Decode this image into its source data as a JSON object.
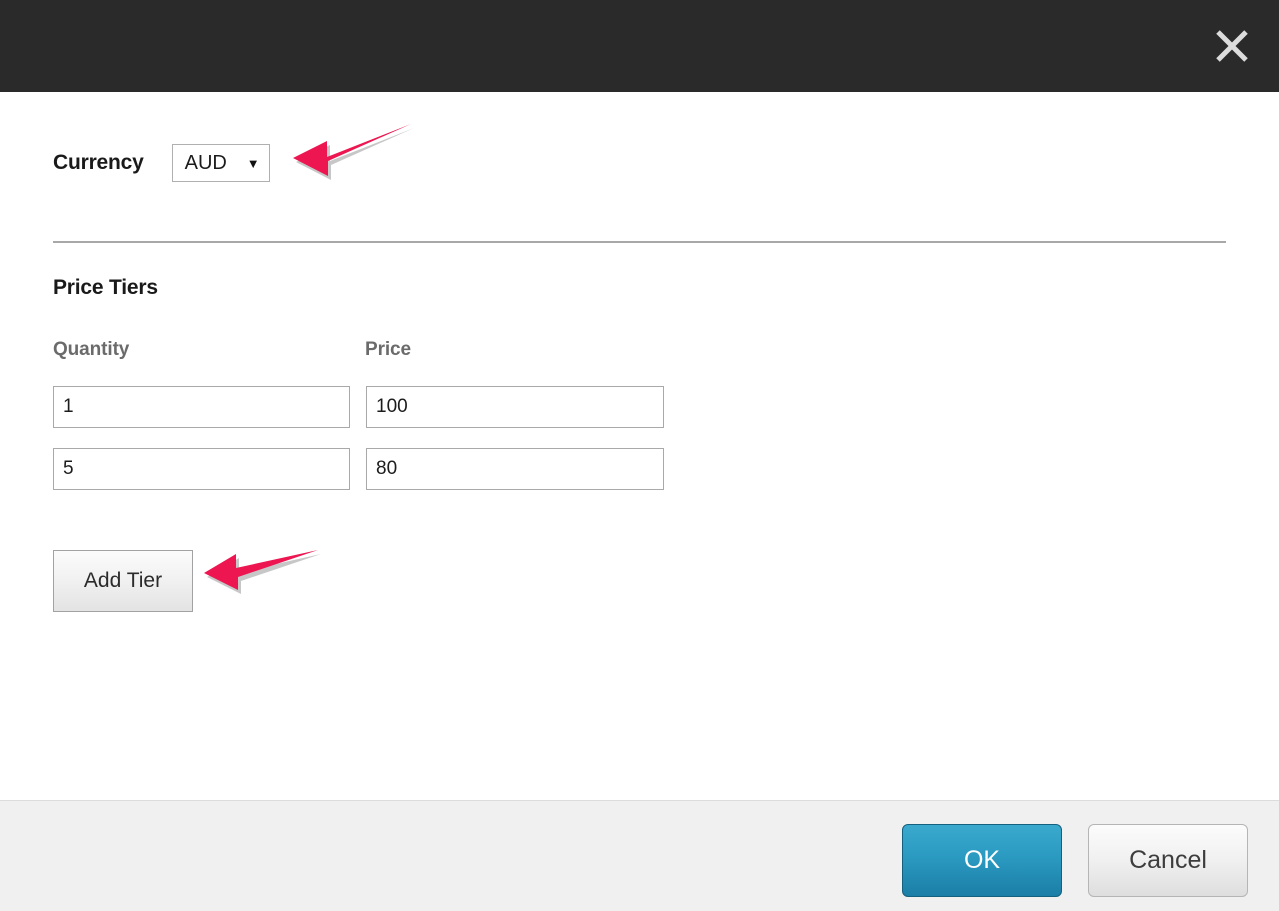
{
  "titlebar": {
    "close_icon": "close-icon",
    "background": "#2a2a2a"
  },
  "form": {
    "currency": {
      "label": "Currency",
      "value": "AUD",
      "caret": "▼"
    },
    "price_tiers": {
      "section_title": "Price Tiers",
      "columns": [
        "Quantity",
        "Price"
      ],
      "rows": [
        {
          "quantity": "1",
          "price": "100"
        },
        {
          "quantity": "5",
          "price": "80"
        }
      ],
      "add_tier_label": "Add Tier"
    }
  },
  "footer": {
    "ok_label": "OK",
    "cancel_label": "Cancel",
    "ok_color": "#2b9ac1",
    "background": "#f0f0f0"
  },
  "annotations": {
    "color": "#ED1651",
    "items": [
      {
        "name": "arrow-pointing-to-currency-dropdown",
        "target": "currency-select"
      },
      {
        "name": "arrow-pointing-to-add-tier-button",
        "target": "add-tier-button"
      }
    ]
  }
}
